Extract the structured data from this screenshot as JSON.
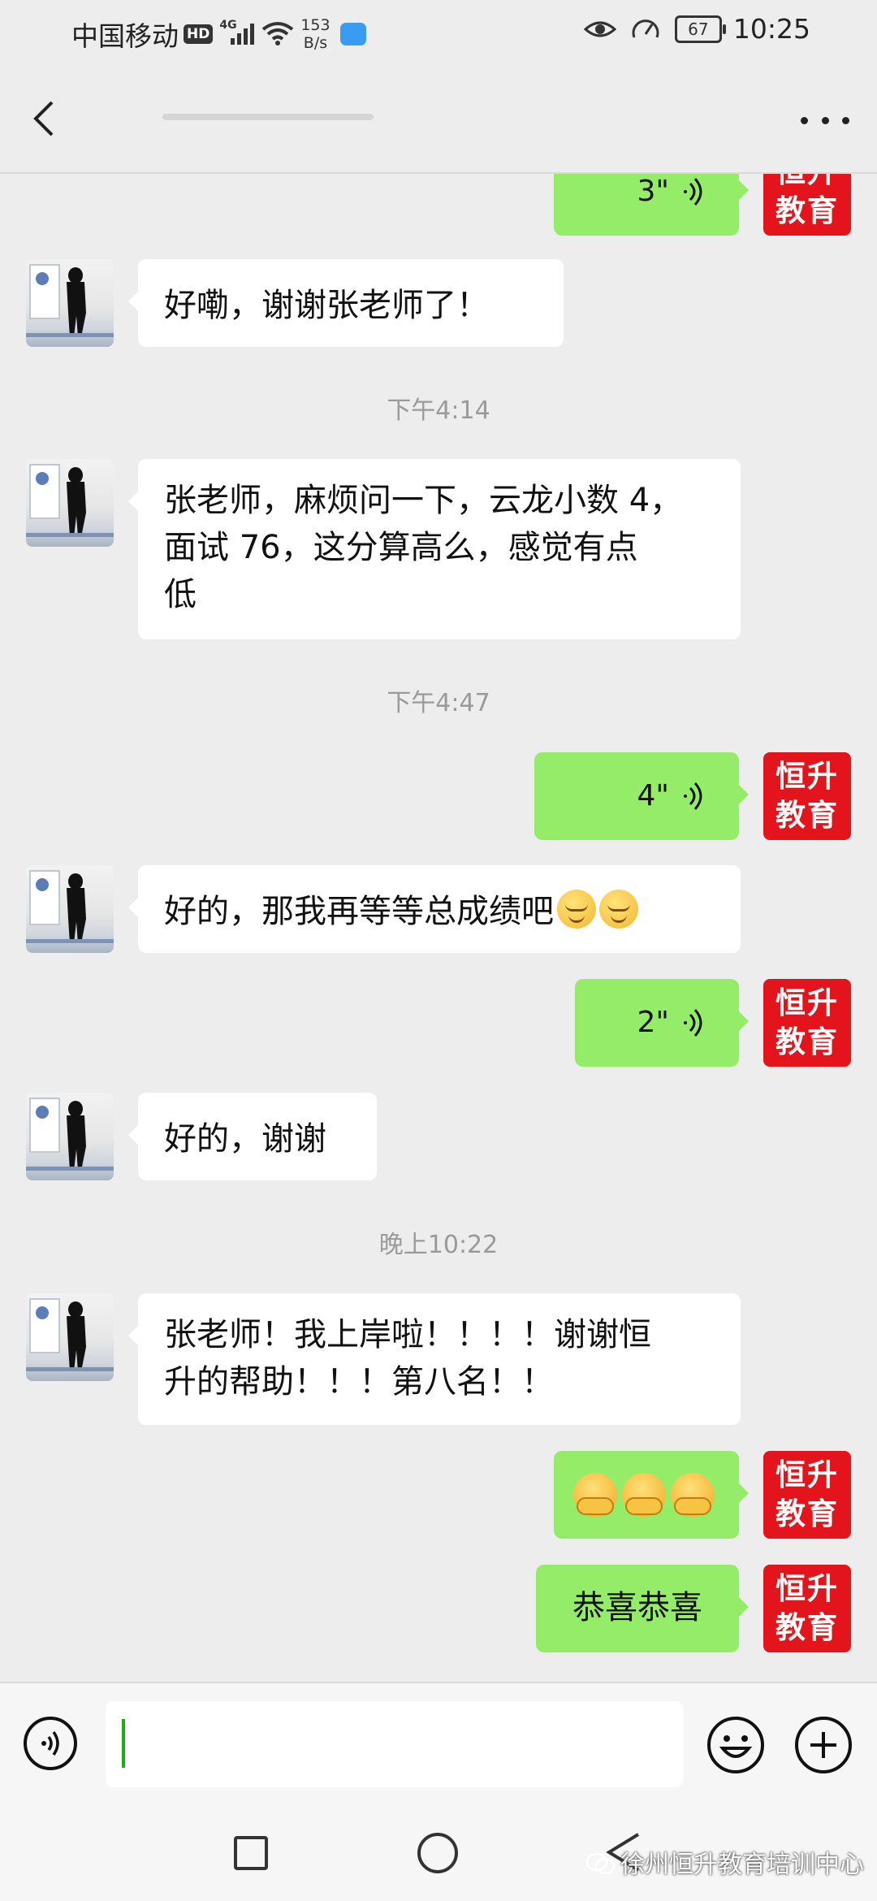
{
  "status_bar": {
    "carrier": "中国移动",
    "hd": "HD",
    "network": "4G",
    "speed_value": "153",
    "speed_unit": "B/s",
    "battery": "67",
    "time": "10:25"
  },
  "header": {
    "title": "",
    "back_icon": "chevron-left-icon",
    "more_icon": "more-dots-icon"
  },
  "brand_avatar": {
    "line1": "恒升",
    "line2": "教育",
    "color": "#e3141c"
  },
  "colors": {
    "outgoing": "#95ec69",
    "incoming": "#ffffff",
    "background": "#ededed"
  },
  "messages": {
    "m1": {
      "duration": "3\""
    },
    "m2": {
      "text": "好嘞，谢谢张老师了！"
    },
    "t1": "下午4:14",
    "m3": {
      "line1": "张老师，麻烦问一下，云龙小数 4，",
      "line2": "面试 76，这分算高么，感觉有点",
      "line3": "低"
    },
    "t2": "下午4:47",
    "m4": {
      "duration": "4\""
    },
    "m5": {
      "text": "好的，那我再等等总成绩吧"
    },
    "m6": {
      "duration": "2\""
    },
    "m7": {
      "text": "好的，谢谢"
    },
    "t3": "晚上10:22",
    "m8": {
      "line1": "张老师！我上岸啦！！！！谢谢恒",
      "line2": "升的帮助！！！第八名！！"
    },
    "m10": {
      "text": "恭喜恭喜"
    }
  },
  "input_bar": {
    "voice_icon": "voice-input-icon",
    "emoji_icon": "emoji-icon",
    "plus_icon": "plus-icon"
  },
  "watermark": "徐州恒升教育培训中心"
}
